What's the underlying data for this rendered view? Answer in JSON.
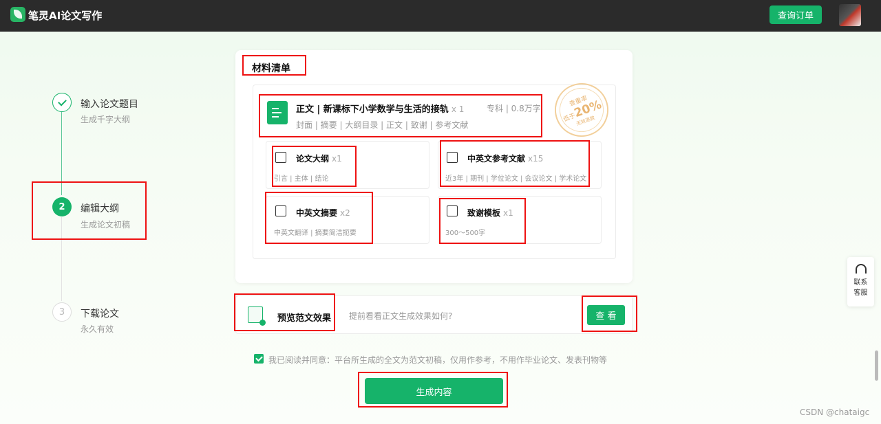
{
  "header": {
    "app_name": "笔灵AI论文写作",
    "order_button": "查询订单",
    "avatar": "user-avatar"
  },
  "steps": [
    {
      "number": "",
      "title": "输入论文题目",
      "sub": "生成千字大纲",
      "status": "done"
    },
    {
      "number": "2",
      "title": "编辑大纲",
      "sub": "生成论文初稿",
      "status": "active"
    },
    {
      "number": "3",
      "title": "下载论文",
      "sub": "永久有效",
      "status": "pending"
    }
  ],
  "materials": {
    "title": "材料清单",
    "main": {
      "title": "正文 | 新课标下小学数学与生活的接轨",
      "qty": "x 1",
      "meta": "专科 | 0.8万字",
      "sub": "封面 | 摘要 | 大纲目录 | 正文 | 致谢 | 参考文献"
    },
    "stamp": {
      "line1": "查重率",
      "line2_prefix": "低于",
      "line2_value": "20%",
      "line3": "无效退款"
    },
    "items": [
      {
        "title": "论文大纲",
        "qty": "x1",
        "sub": "引言 | 主体 | 结论",
        "icon": "book-icon"
      },
      {
        "title": "中英文参考文献",
        "qty": "x15",
        "sub": "近3年 | 期刊 | 学位论文 | 会议论文 | 学术论文",
        "icon": "edit-doc-icon"
      },
      {
        "title": "中英文摘要",
        "qty": "x2",
        "sub": "中英文翻译 | 摘要简洁扼要",
        "icon": "translate-icon"
      },
      {
        "title": "致谢模板",
        "qty": "x1",
        "sub": "300～500字",
        "icon": "heart-doc-icon"
      }
    ]
  },
  "preview": {
    "title": "预览范文效果",
    "hint": "提前看看正文生成效果如何?",
    "button": "查 看"
  },
  "agreement": {
    "checked": true,
    "text": "我已阅读并同意：平台所生成的全文为范文初稿，仅用作参考，不用作毕业论文、发表刊物等"
  },
  "generate_button": "生成内容",
  "service": {
    "line1": "联系",
    "line2": "客服"
  },
  "watermark": "CSDN @chataigc",
  "colors": {
    "accent": "#16b36a",
    "header": "#2b2b2b",
    "highlight": "#e11111"
  }
}
